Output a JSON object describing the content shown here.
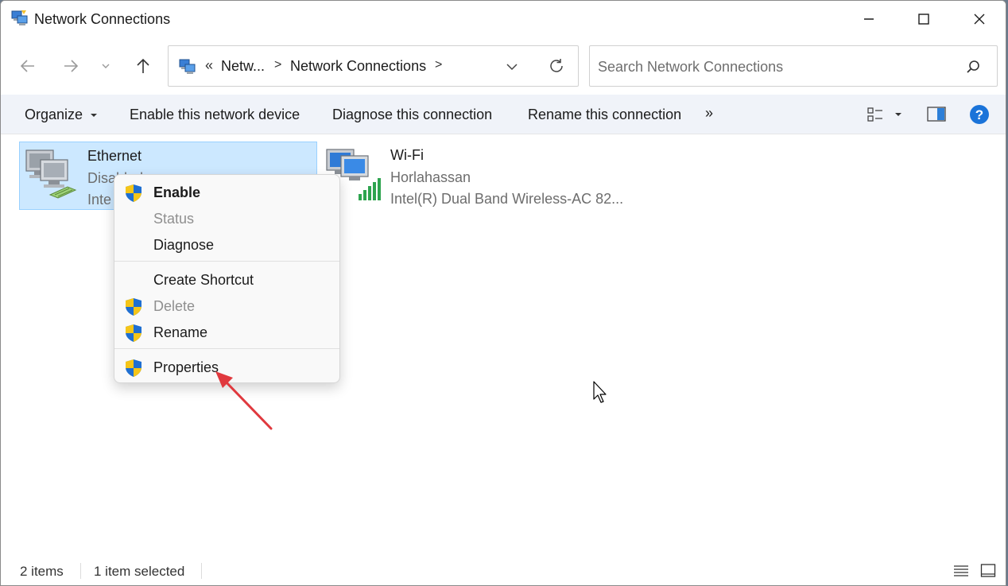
{
  "window": {
    "title": "Network Connections"
  },
  "nav": {
    "breadcrumb_overflow": "«",
    "crumbs": [
      "Netw...",
      "Network Connections"
    ],
    "separator": ">",
    "search_placeholder": "Search Network Connections"
  },
  "toolbar": {
    "organize": "Organize",
    "enable": "Enable this network device",
    "diagnose": "Diagnose this connection",
    "rename": "Rename this connection",
    "more": "»"
  },
  "items": [
    {
      "name": "Ethernet",
      "status": "Disabled",
      "adapter": "Inte"
    },
    {
      "name": "Wi-Fi",
      "status": "Horlahassan",
      "adapter": "Intel(R) Dual Band Wireless-AC 82..."
    }
  ],
  "context_menu": {
    "enable": "Enable",
    "status": "Status",
    "diagnose": "Diagnose",
    "create_shortcut": "Create Shortcut",
    "delete": "Delete",
    "rename": "Rename",
    "properties": "Properties"
  },
  "statusbar": {
    "count": "2 items",
    "selected": "1 item selected"
  },
  "colors": {
    "accent": "#0067c0",
    "selection": "#cce8ff",
    "annotation_arrow": "#e0393e"
  }
}
